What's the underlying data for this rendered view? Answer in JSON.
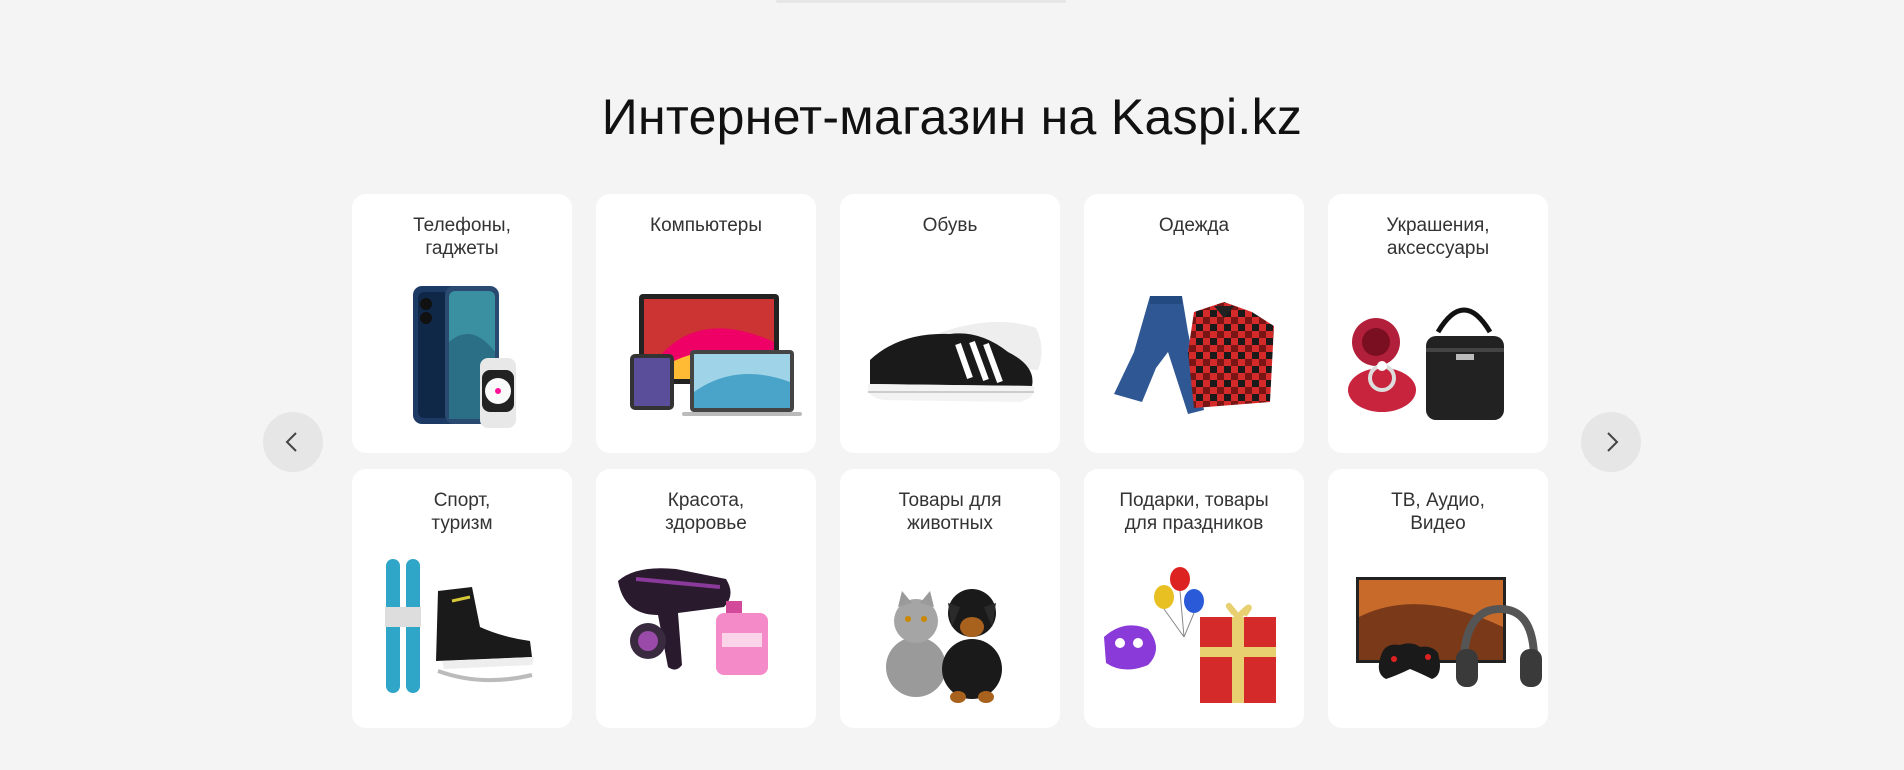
{
  "page_title": "Интернет-магазин на Kaspi.kz",
  "carousel": {
    "prev_icon": "chevron-left-icon",
    "next_icon": "chevron-right-icon"
  },
  "categories": [
    {
      "label": "Телефоны,\nгаджеты",
      "icon": "phone-watch-image"
    },
    {
      "label": "Компьютеры",
      "icon": "computers-image"
    },
    {
      "label": "Обувь",
      "icon": "sneakers-image"
    },
    {
      "label": "Одежда",
      "icon": "clothes-image"
    },
    {
      "label": "Украшения,\nаксессуары",
      "icon": "jewelry-bag-image"
    },
    {
      "label": "Спорт,\nтуризм",
      "icon": "skis-skates-image"
    },
    {
      "label": "Красота,\nздоровье",
      "icon": "hairdryer-perfume-image"
    },
    {
      "label": "Товары для\nживотных",
      "icon": "cat-dog-image"
    },
    {
      "label": "Подарки, товары\nдля праздников",
      "icon": "party-gift-image"
    },
    {
      "label": "ТВ, Аудио,\nВидео",
      "icon": "tv-headphones-image"
    }
  ]
}
